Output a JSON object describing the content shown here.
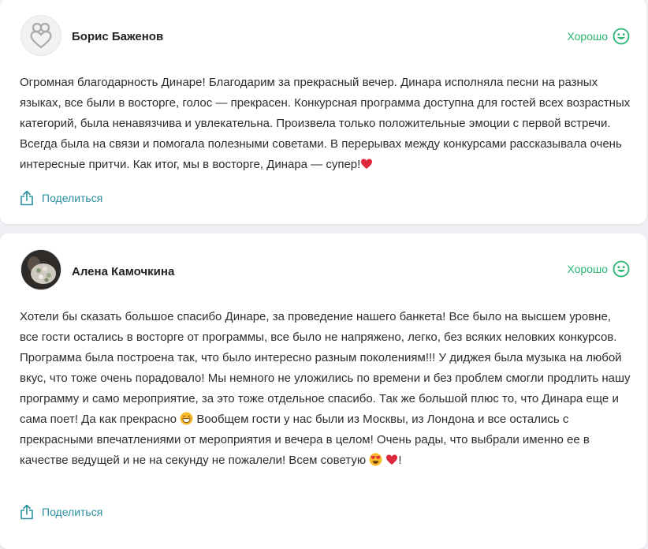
{
  "reviews": [
    {
      "author": "Борис Баженов",
      "rating_label": "Хорошо",
      "text": "Огромная благодарность Динаре! Благодарим за прекрасный вечер. Динара исполняла песни на разных языках, все были в восторге, голос — прекрасен. Конкурсная программа доступна для гостей всех возрастных категорий, была ненавязчива и увлекательна. Произвела только положительные эмоции с первой встречи. Всегда была на связи и помогала полезными советами. В перерывах между конкурсами рассказывала очень интересные притчи. Как итог, мы в восторге, Динара — супер!",
      "text_end_icon": "red-heart-emoji",
      "share_label": "Поделиться"
    },
    {
      "author": "Алена Камочкина",
      "rating_label": "Хорошо",
      "text_part1": "Хотели бы сказать большое спасибо Динаре, за проведение нашего банкета! Все было на высшем уровне, все гости остались в восторге от программы, все было не напряжено, легко, без всяких неловких конкурсов. Программа была построена так, что было интересно разным поколениям!!! У диджея была музыка на любой вкус, что тоже очень порадовало! Мы немного не уложились по времени и без проблем смогли продлить нашу программу и само мероприятие, за это тоже отдельное спасибо. Так же большой плюс то, что Динара еще и сама поет! Да как прекрасно ",
      "text_part2": " Вообщем гости у нас были из Москвы, из Лондона и все остались с прекрасными впечатлениями от мероприятия и вечера в целом! Очень рады, что выбрали именно ее в качестве ведущей и не на секунду не пожалели! Всем советую ",
      "text_part3": "!",
      "inline_icons": [
        "grinning-face-emoji",
        "heart-eyes-emoji",
        "red-heart-emoji"
      ],
      "share_label": "Поделиться"
    }
  ],
  "colors": {
    "rating_green": "#2bb673",
    "share_teal": "#2a8fa0",
    "heart_red": "#e0283c"
  }
}
